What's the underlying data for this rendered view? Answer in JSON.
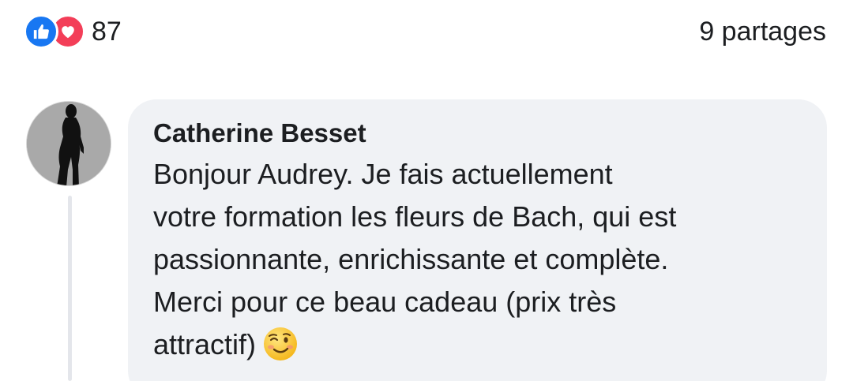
{
  "reactions": {
    "icons": [
      "like-icon",
      "love-icon"
    ],
    "count": "87",
    "like_color": "#1877f2",
    "love_color": "#f33e58"
  },
  "shares": {
    "label": "9 partages"
  },
  "comment": {
    "author": "Catherine Besset",
    "text": "Bonjour Audrey. Je fais actuellement\nvotre formation les fleurs de Bach, qui est\npassionnante, enrichissante et complète.\nMerci pour ce beau cadeau (prix très\nattractif)",
    "emoji": "winking-face-emoji",
    "bubble_color": "#f0f2f5"
  }
}
